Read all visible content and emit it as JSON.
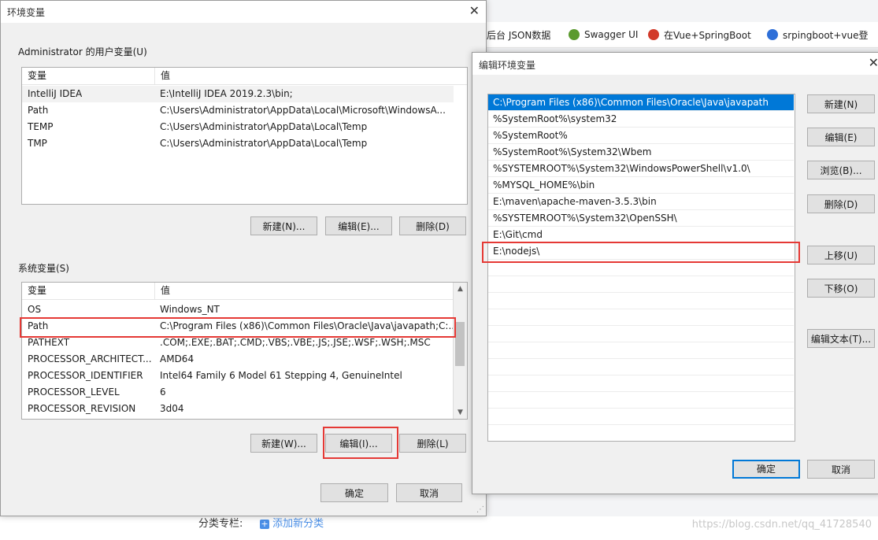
{
  "background": {
    "bookmarks": [
      {
        "label": "后台 JSON数据",
        "icon": "page-icon",
        "color": "#ffffff"
      },
      {
        "label": "Swagger UI",
        "icon": "swagger-icon",
        "color": "#5b9a2e"
      },
      {
        "label": "在Vue+SpringBoot",
        "icon": "php-icon",
        "color": "#d23a2a"
      },
      {
        "label": "srpingboot+vue登",
        "icon": "paw-icon",
        "color": "#2e6fd8"
      }
    ],
    "category_label": "分类专栏:",
    "add_category_label": "添加新分类",
    "watermark": "https://blog.csdn.net/qq_41728540"
  },
  "env_dialog": {
    "title": "环境变量",
    "user_group_label": "Administrator 的用户变量(U)",
    "columns": {
      "name": "变量",
      "value": "值"
    },
    "user_vars": [
      {
        "name": "IntelliJ IDEA",
        "value": "E:\\IntelliJ IDEA 2019.2.3\\bin;"
      },
      {
        "name": "Path",
        "value": "C:\\Users\\Administrator\\AppData\\Local\\Microsoft\\WindowsA..."
      },
      {
        "name": "TEMP",
        "value": "C:\\Users\\Administrator\\AppData\\Local\\Temp"
      },
      {
        "name": "TMP",
        "value": "C:\\Users\\Administrator\\AppData\\Local\\Temp"
      }
    ],
    "user_buttons": {
      "new": "新建(N)...",
      "edit": "编辑(E)...",
      "delete": "删除(D)"
    },
    "system_group_label": "系统变量(S)",
    "system_vars": [
      {
        "name": "OS",
        "value": "Windows_NT"
      },
      {
        "name": "Path",
        "value": "C:\\Program Files (x86)\\Common Files\\Oracle\\Java\\javapath;C:..."
      },
      {
        "name": "PATHEXT",
        "value": ".COM;.EXE;.BAT;.CMD;.VBS;.VBE;.JS;.JSE;.WSF;.WSH;.MSC"
      },
      {
        "name": "PROCESSOR_ARCHITECT...",
        "value": "AMD64"
      },
      {
        "name": "PROCESSOR_IDENTIFIER",
        "value": "Intel64 Family 6 Model 61 Stepping 4, GenuineIntel"
      },
      {
        "name": "PROCESSOR_LEVEL",
        "value": "6"
      },
      {
        "name": "PROCESSOR_REVISION",
        "value": "3d04"
      }
    ],
    "system_buttons": {
      "new": "新建(W)...",
      "edit": "编辑(I)...",
      "delete": "删除(L)"
    },
    "ok": "确定",
    "cancel": "取消"
  },
  "edit_dialog": {
    "title": "编辑环境变量",
    "entries": [
      "C:\\Program Files (x86)\\Common Files\\Oracle\\Java\\javapath",
      "%SystemRoot%\\system32",
      "%SystemRoot%",
      "%SystemRoot%\\System32\\Wbem",
      "%SYSTEMROOT%\\System32\\WindowsPowerShell\\v1.0\\",
      "%MYSQL_HOME%\\bin",
      "E:\\maven\\apache-maven-3.5.3\\bin",
      "%SYSTEMROOT%\\System32\\OpenSSH\\",
      "E:\\Git\\cmd",
      "E:\\nodejs\\"
    ],
    "buttons": {
      "new": "新建(N)",
      "edit": "编辑(E)",
      "browse": "浏览(B)...",
      "delete": "删除(D)",
      "move_up": "上移(U)",
      "move_down": "下移(O)",
      "edit_text": "编辑文本(T)..."
    },
    "ok": "确定",
    "cancel": "取消",
    "highlight_color": "#e53935",
    "selection_color": "#0078d7"
  }
}
